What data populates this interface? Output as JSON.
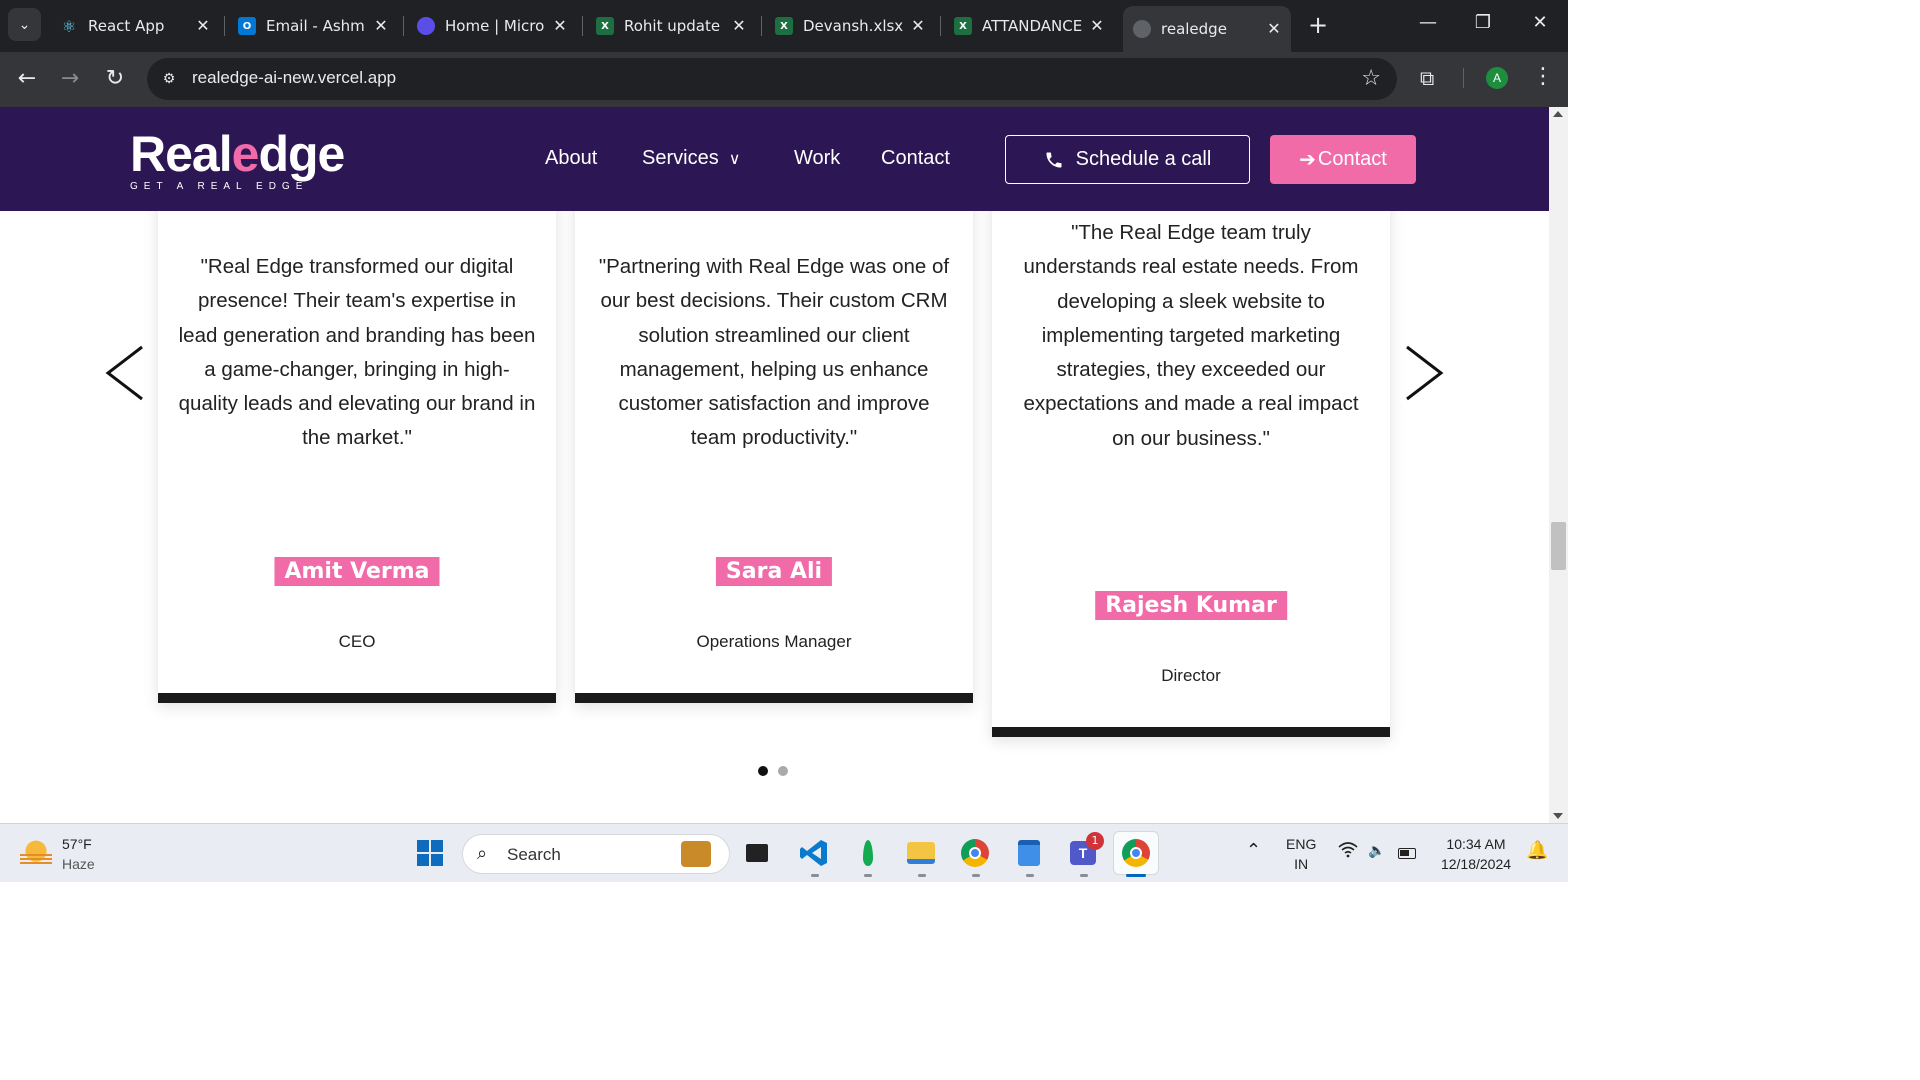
{
  "browser": {
    "tabs": [
      {
        "title": "React App",
        "favicon": "react-icon",
        "color": "#61dafb"
      },
      {
        "title": "Email - Ashmit",
        "favicon": "outlook-icon",
        "color": "#0078d4"
      },
      {
        "title": "Home | Microsoft",
        "favicon": "copilot-icon",
        "color": "#7b61ff"
      },
      {
        "title": "Rohit update",
        "favicon": "excel-icon",
        "color": "#1d6f42"
      },
      {
        "title": "Devansh.xlsx",
        "favicon": "excel-icon",
        "color": "#1d6f42"
      },
      {
        "title": "ATTANDANCE",
        "favicon": "excel-icon",
        "color": "#1d6f42"
      },
      {
        "title": "realedge",
        "favicon": "globe-icon",
        "color": "#9aa0a6"
      }
    ],
    "url": "realedge-ai-new.vercel.app",
    "profile_initial": "A"
  },
  "site": {
    "logo_text_start": "Real",
    "logo_text_e": "e",
    "logo_text_end": "dge",
    "logo_tagline": "GET A REAL EDGE",
    "nav": {
      "about": "About",
      "services": "Services",
      "work": "Work",
      "contact": "Contact"
    },
    "schedule_label": "Schedule a call",
    "contact_label": "Contact",
    "accent": "#f06ba8",
    "header_bg": "#2c1654"
  },
  "testimonials": [
    {
      "quote": "\"Real Edge transformed our digital presence! Their team's expertise in lead generation and branding has been a game-changer, bringing in high-quality leads and elevating our brand in the market.\"",
      "name": "Amit Verma",
      "role": "CEO"
    },
    {
      "quote": "\"Partnering with Real Edge was one of our best decisions. Their custom CRM solution streamlined our client management, helping us enhance customer satisfaction and improve team productivity.\"",
      "name": "Sara Ali",
      "role": "Operations Manager"
    },
    {
      "quote": "\"The Real Edge team truly understands real estate needs. From developing a sleek website to implementing targeted marketing strategies, they exceeded our expectations and made a real impact on our business.\"",
      "name": "Rajesh Kumar",
      "role": "Director"
    }
  ],
  "carousel": {
    "pages": 2,
    "active": 1
  },
  "taskbar": {
    "weather_temp": "57°F",
    "weather_desc": "Haze",
    "search_placeholder": "Search",
    "language": "ENG",
    "region": "IN",
    "time": "10:34 AM",
    "date": "12/18/2024",
    "teams_badge": "1"
  }
}
